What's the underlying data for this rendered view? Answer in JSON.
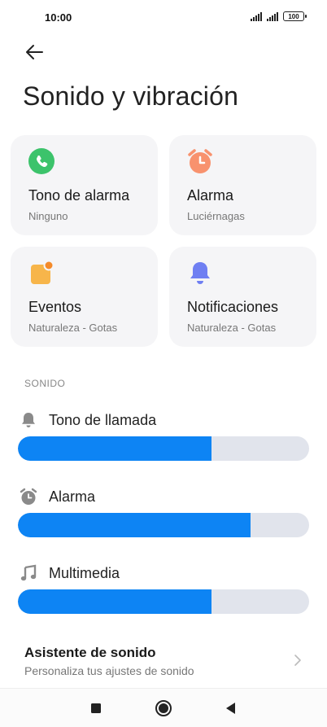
{
  "status_bar": {
    "time": "10:00",
    "battery": "100"
  },
  "header": {
    "title": "Sonido y vibración"
  },
  "cards": [
    {
      "title": "Tono de alarma",
      "subtitle": "Ninguno",
      "icon": "phone-icon",
      "color": "#3cc36b"
    },
    {
      "title": "Alarma",
      "subtitle": "Luciérnagas",
      "icon": "alarm-clock-icon",
      "color": "#f8926e"
    },
    {
      "title": "Eventos",
      "subtitle": "Naturaleza - Gotas",
      "icon": "calendar-event-icon",
      "color": "#f7b54a"
    },
    {
      "title": "Notificaciones",
      "subtitle": "Naturaleza - Gotas",
      "icon": "bell-icon",
      "color": "#6f7ff2"
    }
  ],
  "section": {
    "label": "SONIDO"
  },
  "sliders": [
    {
      "label": "Tono de llamada",
      "icon": "bell-icon",
      "level": 0.665
    },
    {
      "label": "Alarma",
      "icon": "alarm-clock-icon",
      "level": 0.8
    },
    {
      "label": "Multimedia",
      "icon": "music-note-icon",
      "level": 0.665
    }
  ],
  "assistant": {
    "title": "Asistente de sonido",
    "subtitle": "Personaliza tus ajustes de sonido"
  },
  "colors": {
    "accent": "#0d84f4",
    "track": "#e1e4ec",
    "card_bg": "#f5f5f7"
  }
}
